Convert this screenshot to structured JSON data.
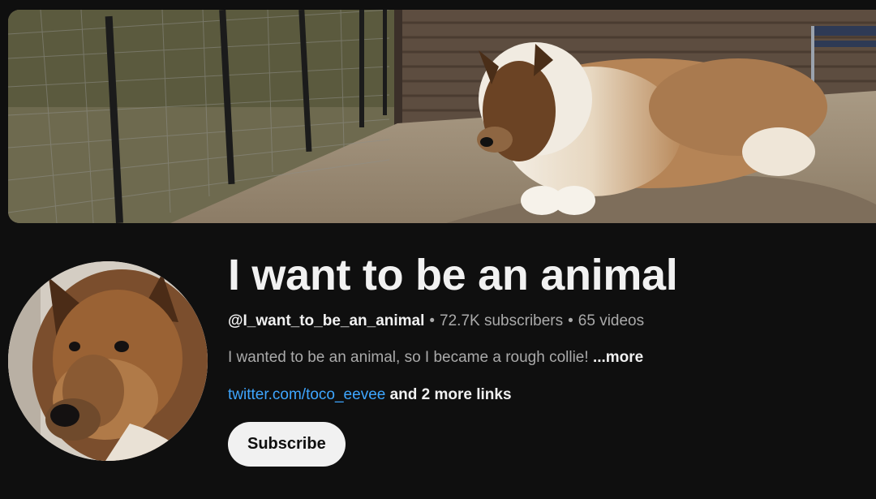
{
  "banner": {
    "image": "collie-costume-banner"
  },
  "avatar": {
    "image": "collie-costume-portrait"
  },
  "channel": {
    "title": "I want to be an animal",
    "handle": "@I_want_to_be_an_animal",
    "separator": "•",
    "subscribers": "72.7K subscribers",
    "videos": "65 videos",
    "description": "I wanted to be an animal, so I became a rough collie!",
    "more_label": "...more",
    "link": "twitter.com/toco_eevee",
    "more_links": "and 2 more links",
    "subscribe_label": "Subscribe"
  },
  "colors": {
    "background": "#0f0f0f",
    "text_primary": "#f1f1f1",
    "text_secondary": "#aaaaaa",
    "link": "#3ea6ff",
    "button_bg": "#f1f1f1"
  }
}
